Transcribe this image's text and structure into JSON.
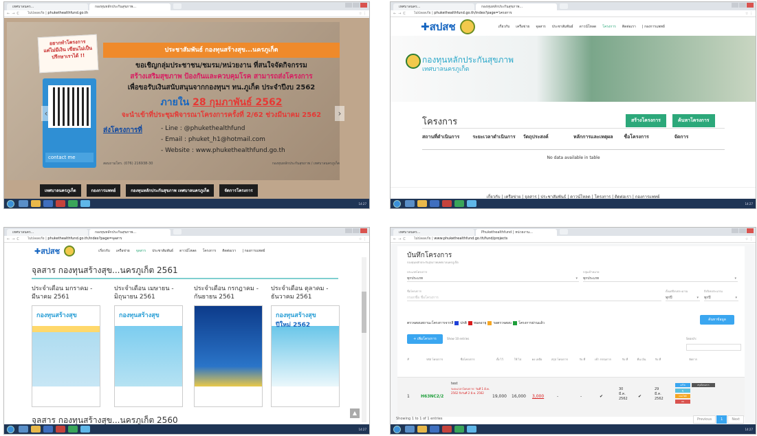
{
  "q1": {
    "tab1": "เทศบาลนคร...",
    "tab2": "กองทุนหลักประกันสุขภาพ...",
    "url_prefix": "ไม่ปลอดภัย",
    "url": "phukethealthfund.go.th",
    "note": [
      "อยากทำโครงการ",
      "แต่ไม่มีเงิน เขียนไม่เป็น",
      "ปรึกษาเราได้ !!"
    ],
    "contact": "contact me",
    "banner": "ประชาสัมพันธ์ กองทุนสร้างสุข...นครภูเก็ต",
    "line1": "ขอเชิญกลุ่มประชาชน/ชมรม/หน่วยงาน ที่สนใจจัดกิจกรรม",
    "line2": "สร้างเสริมสุขภาพ ป้องกันและควบคุมโรค สามารถส่งโครงการ",
    "line3": "เพื่อขอรับเงินสนับสนุนจากกองทุนฯ ทน.ภูเก็ต ประจำปีงบ 2562",
    "within": "ภายใน",
    "deadline": "28 กุมภาพันธ์ 2562",
    "line5": "จะนำเข้าที่ประชุมพิจารณาโครงการครั้งที่ 2/62 ช่วงมีนาคม 2562",
    "send": "ส่งโครงการที่",
    "ch1": "- Line : @phukethealthfund",
    "ch2": "- Email : phuket_h1@hotmail.com",
    "ch3": "- Website : www.phukethealthfund.go.th",
    "foot_l": "สอบถามโทร. (076) 216938-30",
    "foot_r": "กองทุนหลักประกันสุขภาพ / เทศบาลนครภูเก็ต",
    "buttons": [
      "เทศบาลนครภูเก็ต",
      "กองการแพทย์",
      "กองทุนหลักประกันสุขภาพ เทศบาลนครภูเก็ต",
      "จัดการโครงการ"
    ]
  },
  "q2": {
    "tab1": "เทศบาลนคร...",
    "tab2": "กองทุนหลักประกันสุขภาพ...",
    "url_prefix": "ไม่ปลอดภัย",
    "url": "phukethealthfund.go.th/index?page=โครงการ",
    "logo": "สปสช",
    "menu": [
      "เกี่ยวกับ",
      "เครือข่าย",
      "จุลสาร",
      "ประชาสัมพันธ์",
      "ดาวน์โหลด",
      "โครงการ",
      "ติดต่อเรา",
      "| กองการแพทย์"
    ],
    "hero_title": "กองทุนหลักประกันสุขภาพ",
    "hero_sub": "เทศบาลนครภูเก็ต",
    "title": "โครงการ",
    "create": "สร้างโครงการ",
    "search": "ค้นหาโครงการ",
    "cols": [
      "สถานที่ดำเนินการ",
      "ระยะเวลาดำเนินการ",
      "วัตถุประสงค์",
      "หลักการและเหตุผล",
      "ชื่อโครงการ",
      "จัดการ"
    ],
    "nodata": "No data available in table",
    "footer": "เกี่ยวกับ | เครือข่าย | จุลสาร | ประชาสัมพันธ์ | ดาวน์โหลด | โครงการ | ติดต่อเรา | กองการแพทย์"
  },
  "q3": {
    "tab1": "เทศบาลนคร...",
    "tab2": "กองทุนหลักประกันสุขภาพ...",
    "url_prefix": "ไม่ปลอดภัย",
    "url": "phukethealthfund.go.th/index?page=จุลสาร",
    "logo": "สปสช",
    "menu": [
      "เกี่ยวกับ",
      "เครือข่าย",
      "จุลสาร",
      "ประชาสัมพันธ์",
      "ดาวน์โหลด",
      "โครงการ",
      "ติดต่อเรา",
      "| กองการแพทย์"
    ],
    "section": "จุลสาร กองทุนสร้างสุข...นครภูเก็ต 2561",
    "months": [
      [
        "ประจำเดือน มกราคม -",
        "มีนาคม 2561"
      ],
      [
        "ประจำเดือน เมษายน -",
        "มิถุนายน 2561"
      ],
      [
        "ประจำเดือน กรกฎาคม -",
        "กันยายน 2561"
      ],
      [
        "ประจำเดือน ตุลาคม -",
        "ธันวาคม 2561"
      ]
    ],
    "cover_title": "กองทุนสร้างสุข",
    "cover4_sub": "ปีใหม่ 2562",
    "section2": "จุลสาร กองทุนสร้างสุข...นครภูเก็ต 2560"
  },
  "q4": {
    "tab1": "เทศบาลนคร...",
    "tab2": "Phukethealthfund | หน่วยงาน...",
    "url_prefix": "ไม่ปลอดภัย",
    "url": "www.phukethealthfund.go.th/fund/projects",
    "title": "บันทึกโครงการ",
    "subtitle": "กองทุนหลักประกันสุขภาพเทศบาลนครภูเก็ต",
    "l_type": "ประเภทโครงการ",
    "v_type": "ทุกประเภท",
    "l_group": "กลุ่มเป้าหมาย",
    "v_group": "ทุกประเภท",
    "l_name": "ชื่อโครงการ",
    "v_name": "กรอกชื่อ ชื่อโครงการ",
    "l_start": "ตั้งแต่ปีงบประมาณ",
    "v_start": "ทุกปี",
    "l_end": "ถึงปีงบประมาณ",
    "v_end": "ทุกปี",
    "legend_lead": "ตรวจสอบสถานะโครงการจากสี",
    "legend": [
      {
        "label": "ปกติ",
        "color": "#1e3fd8"
      },
      {
        "label": "หมดอายุ",
        "color": "#d81b1b"
      },
      {
        "label": "รอตรวจสอบ",
        "color": "#f5a623"
      },
      {
        "label": "โครงการผ่านแล้ว",
        "color": "#1e9e3a"
      }
    ],
    "search_btn": "ค้นหาข้อมูล",
    "add_btn": "+ เพิ่มโครงการ",
    "show": "Show 10 entries",
    "search_lbl": "Search:",
    "heads": [
      "#",
      "รหัส โครงการ",
      "ชื่อโครงการ",
      "ตั้ง ไว้",
      "ใช้ ไป",
      "คง เหลือ",
      "สรุป โครงการ",
      "รับ ที่",
      "เข้า กรรมการ",
      "รับ ที่",
      "คืน เงิน",
      "รับ ที่",
      "จัดการ"
    ],
    "row": {
      "n": "1",
      "code": "H63NC2/2",
      "name_a": "test",
      "name_b": "ระยะเวลาโครงการ: วันที่ 1 มี.ค. 2562 ถึงวันที่ 2 มี.ค. 2562",
      "set": "19,000",
      "used": "16,000",
      "left": "3,000",
      "dash1": "-",
      "dash2": "-",
      "check1": "✔",
      "d1": [
        "30",
        "มี.ค.",
        "2562"
      ],
      "check2": "✔",
      "d2": [
        "29",
        "มี.ค.",
        "2562"
      ]
    },
    "actions": [
      "แก้ไข",
      "ดู",
      "แนบไฟล์",
      "ลบ"
    ],
    "summary": "สรุปโครงการ",
    "showing": "Showing 1 to 1 of 1 entries",
    "prev": "Previous",
    "page": "1",
    "next": "Next"
  },
  "taskbar_clock": "14:27"
}
